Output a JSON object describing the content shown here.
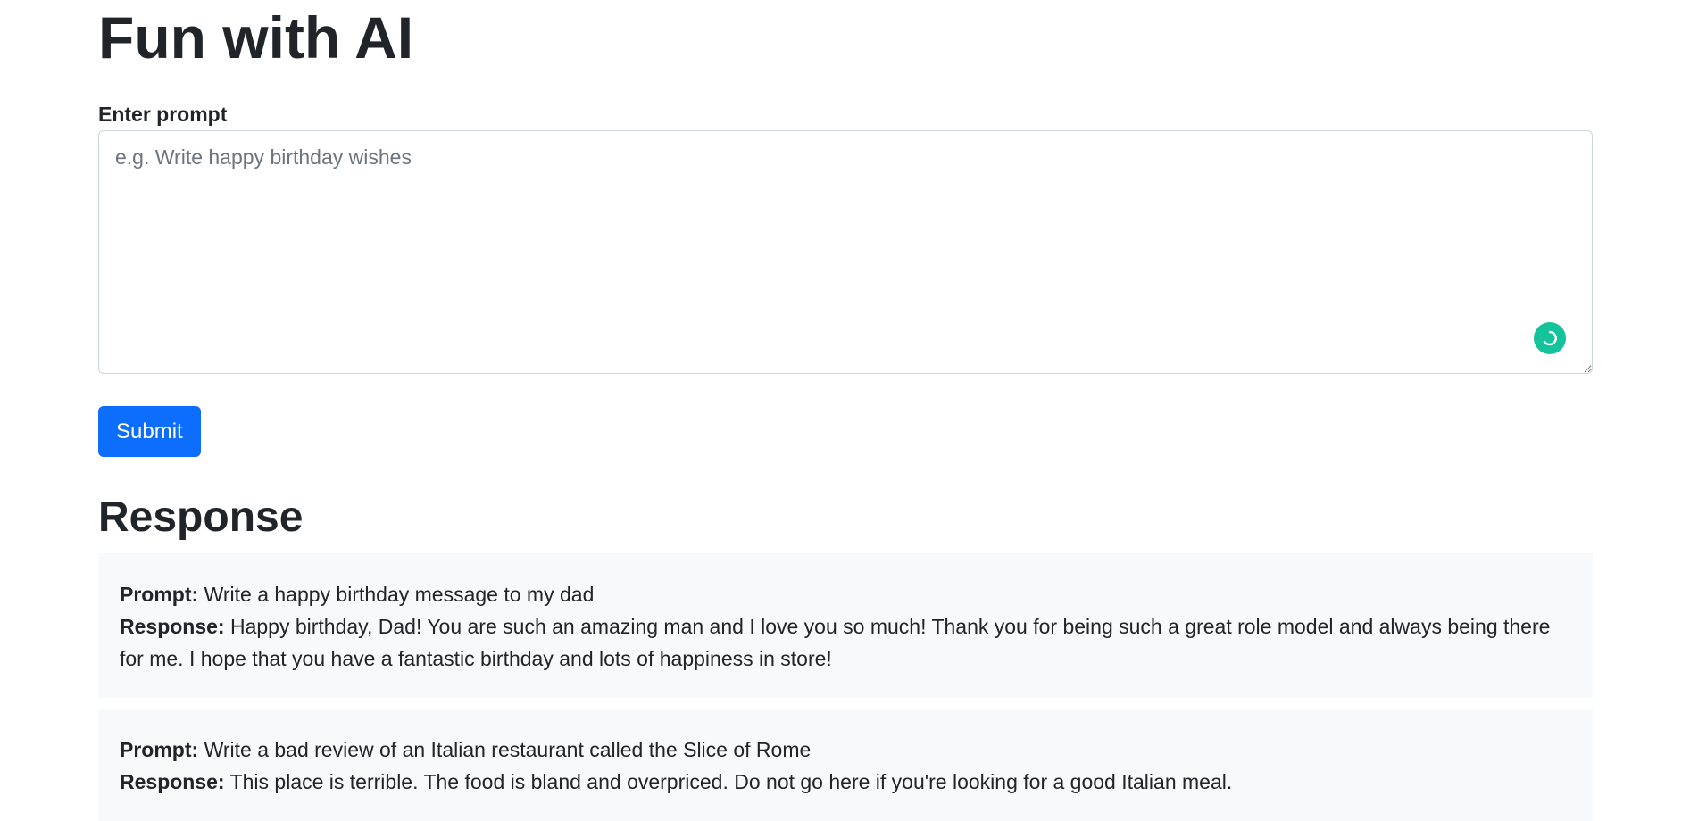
{
  "header": {
    "title": "Fun with AI"
  },
  "form": {
    "label": "Enter prompt",
    "placeholder": "e.g. Write happy birthday wishes",
    "value": "",
    "submit_label": "Submit",
    "grammar_icon": "grammarly-badge-icon"
  },
  "responses": {
    "title": "Response",
    "prompt_label": "Prompt:",
    "response_label": "Response:",
    "items": [
      {
        "prompt": "Write a happy birthday message to my dad",
        "response": "Happy birthday, Dad! You are such an amazing man and I love you so much! Thank you for being such a great role model and always being there for me. I hope that you have a fantastic birthday and lots of happiness in store!"
      },
      {
        "prompt": "Write a bad review of an Italian restaurant called the Slice of Rome",
        "response": "This place is terrible. The food is bland and overpriced. Do not go here if you're looking for a good Italian meal."
      }
    ]
  },
  "colors": {
    "primary": "#0d6efd",
    "card_background": "#f8f9fa",
    "grammar_badge": "#15c39a"
  }
}
